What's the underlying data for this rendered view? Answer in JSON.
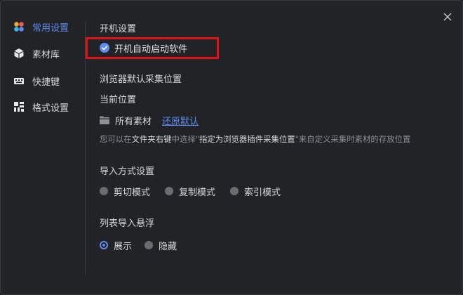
{
  "sidebar": {
    "items": [
      {
        "label": "常用设置",
        "icon": "palette-icon",
        "active": true
      },
      {
        "label": "素材库",
        "icon": "cube-icon",
        "active": false
      },
      {
        "label": "快捷键",
        "icon": "keyboard-icon",
        "active": false
      },
      {
        "label": "格式设置",
        "icon": "grid-icon",
        "active": false
      }
    ]
  },
  "startup": {
    "heading": "开机设置",
    "checkbox_label": "开机自动启动软件",
    "checked": true
  },
  "browser": {
    "heading": "浏览器默认采集位置",
    "current_label": "当前位置",
    "folder_name": "所有素材",
    "restore_label": "还原默认",
    "hint_prefix": "您可以在",
    "hint_em1": "文件夹右键",
    "hint_mid": "中选择\"",
    "hint_em2": "指定为浏览器插件采集位置",
    "hint_suffix": "\"来自定义采集时素材的存放位置"
  },
  "import": {
    "heading": "导入方式设置",
    "options": [
      "剪切模式",
      "复制模式",
      "索引模式"
    ],
    "selected": null
  },
  "float": {
    "heading": "列表导入悬浮",
    "options": [
      "展示",
      "隐藏"
    ],
    "selected": "展示"
  },
  "colors": {
    "accent": "#5e8cf0",
    "highlight": "#e0111a",
    "background": "#222326"
  }
}
